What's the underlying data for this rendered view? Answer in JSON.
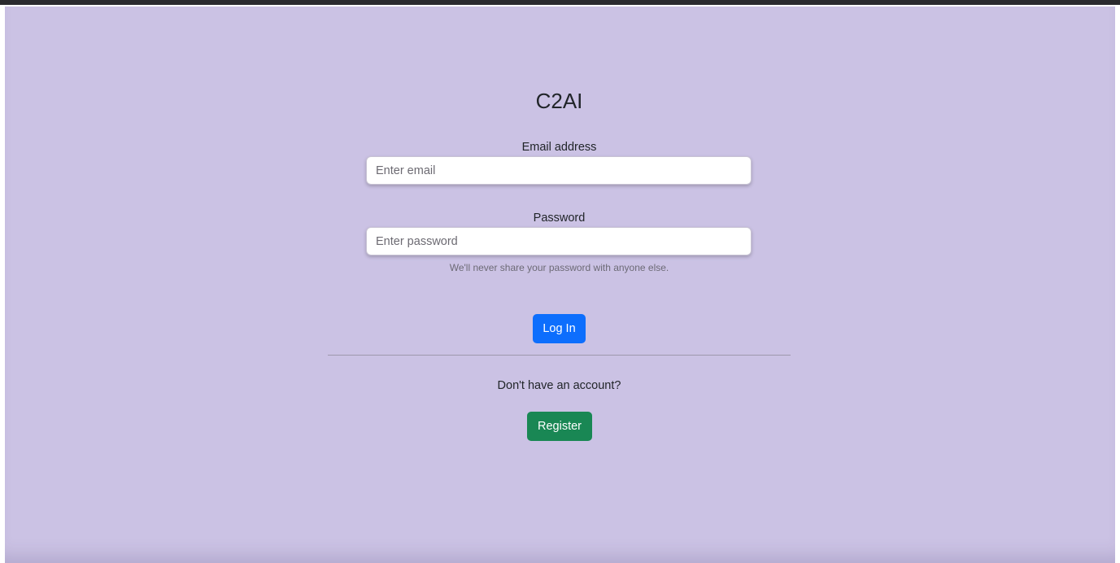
{
  "app": {
    "title": "C2AI"
  },
  "login_form": {
    "email_label": "Email address",
    "email_value": "",
    "email_placeholder": "Enter email",
    "password_label": "Password",
    "password_value": "",
    "password_placeholder": "Enter password",
    "password_help": "We'll never share your password with anyone else.",
    "login_label": "Log In"
  },
  "register_section": {
    "prompt": "Don't have an account?",
    "register_label": "Register"
  },
  "colors": {
    "background": "#cbc2e4",
    "primary_button": "#0d6efd",
    "success_button": "#198754"
  }
}
